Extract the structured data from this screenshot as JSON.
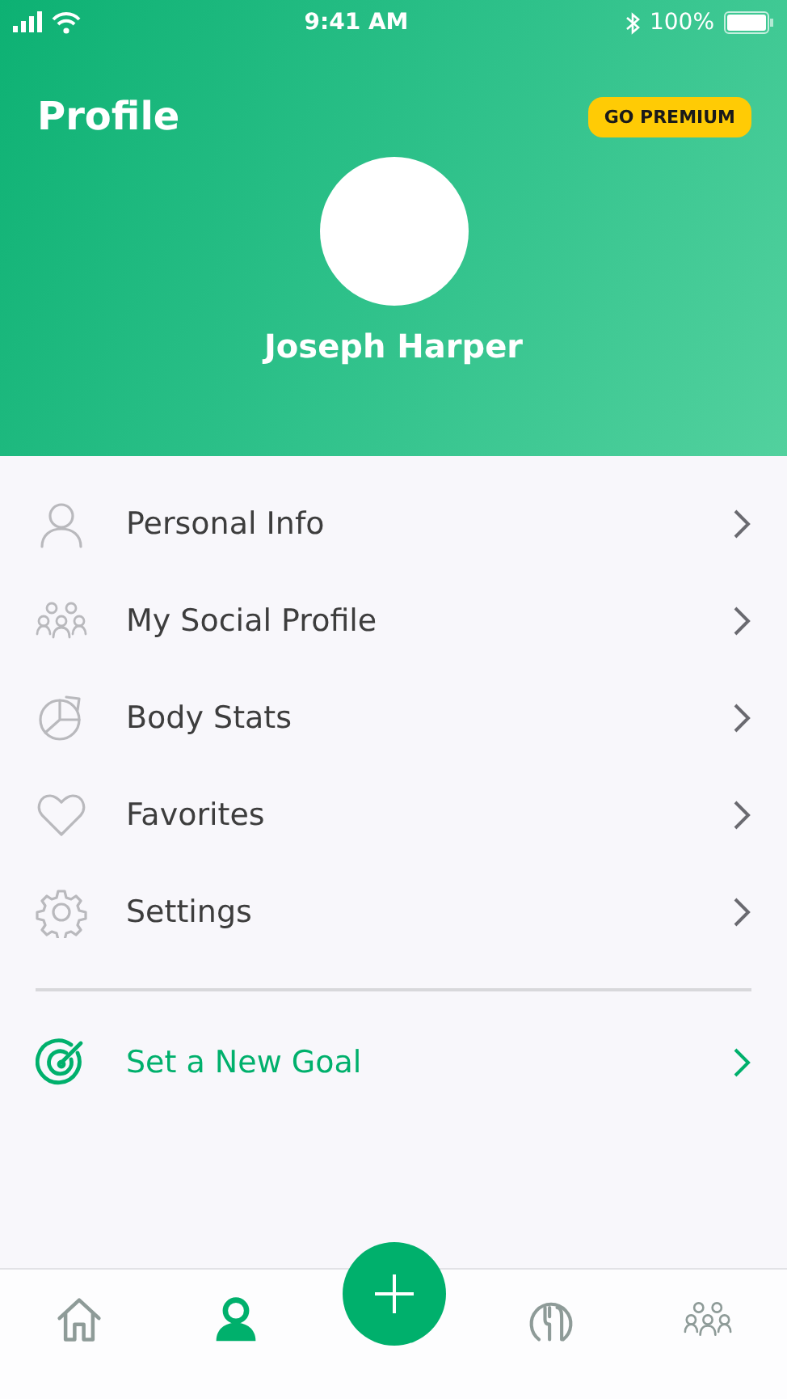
{
  "status_bar": {
    "time": "9:41 AM",
    "battery": "100%"
  },
  "header": {
    "title": "Profile",
    "premium_button": "GO PREMIUM",
    "user_name": "Joseph Harper"
  },
  "menu": [
    {
      "kind": "person",
      "label": "Personal Info"
    },
    {
      "kind": "group",
      "label": "My Social Profile"
    },
    {
      "kind": "chart",
      "label": "Body Stats"
    },
    {
      "kind": "heart",
      "label": "Favorites"
    },
    {
      "kind": "gear",
      "label": "Settings"
    }
  ],
  "goal": {
    "label": "Set a New Goal"
  },
  "tab_bar": [
    {
      "kind": "home",
      "selected": false
    },
    {
      "kind": "person",
      "selected": true
    },
    {
      "kind": "fab"
    },
    {
      "kind": "food",
      "selected": false
    },
    {
      "kind": "group",
      "selected": false
    }
  ]
}
